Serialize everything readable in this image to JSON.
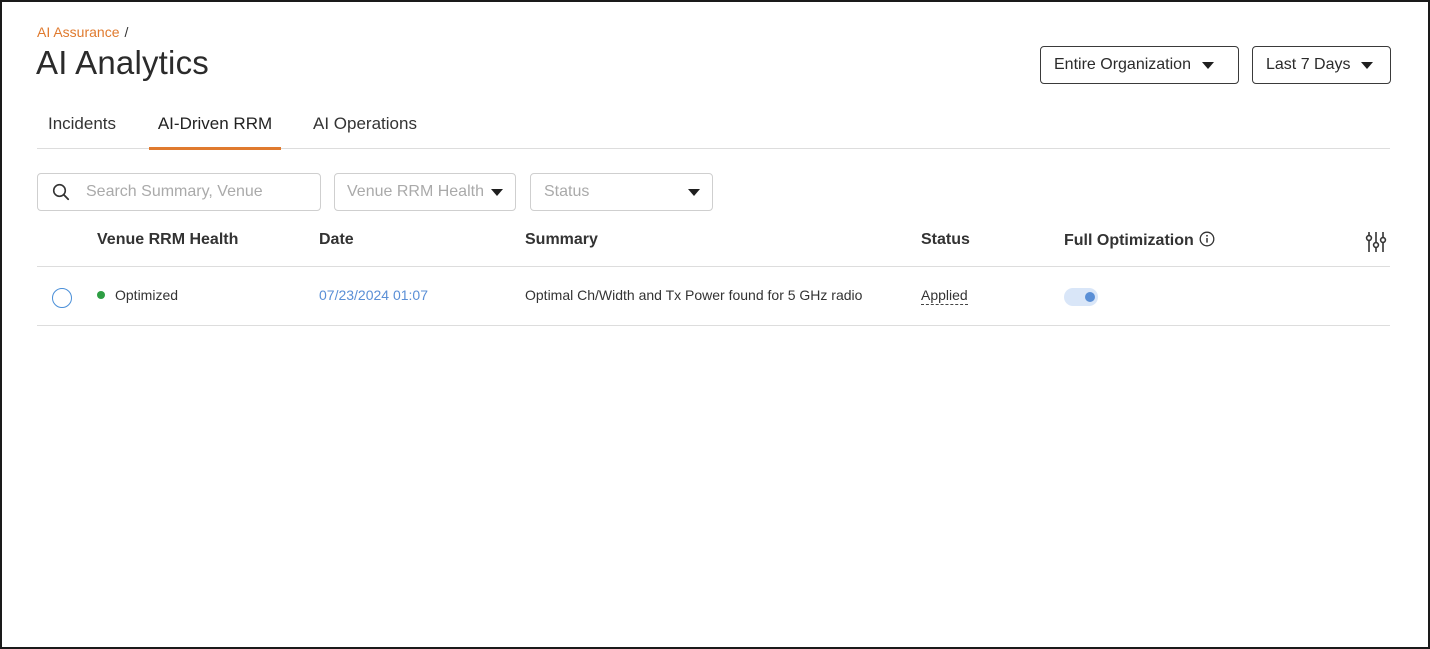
{
  "breadcrumb": {
    "parent": "AI Assurance",
    "separator": "/"
  },
  "page": {
    "title": "AI Analytics"
  },
  "selectors": {
    "scope": "Entire Organization",
    "range": "Last 7 Days"
  },
  "tabs": [
    {
      "label": "Incidents",
      "active": false
    },
    {
      "label": "AI-Driven RRM",
      "active": true
    },
    {
      "label": "AI Operations",
      "active": false
    }
  ],
  "filters": {
    "search_placeholder": "Search Summary, Venue",
    "health_placeholder": "Venue RRM Health",
    "status_placeholder": "Status"
  },
  "table": {
    "columns": [
      "Venue RRM Health",
      "Date",
      "Summary",
      "Status",
      "Full Optimization"
    ],
    "rows": [
      {
        "health": "Optimized",
        "date": "07/23/2024 01:07",
        "summary": "Optimal Ch/Width and Tx Power found for 5 GHz radio",
        "status": "Applied",
        "full_optimization": true
      }
    ]
  },
  "colors": {
    "accent": "#e07a2e",
    "link": "#5a8fd6",
    "optimized": "#2e9e44"
  },
  "icons": [
    "search-icon",
    "chevron-down-icon",
    "info-icon",
    "settings-sliders-icon"
  ]
}
